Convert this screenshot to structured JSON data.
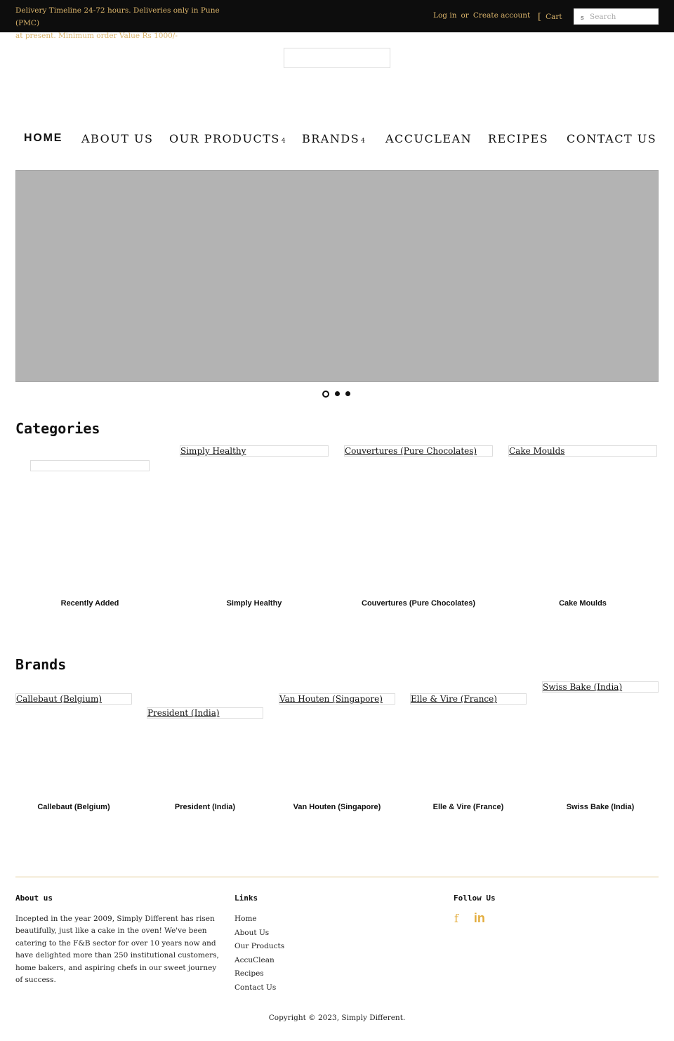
{
  "topbar": {
    "announcement_line1": "Delivery Timeline 24-72 hours. Deliveries only in Pune (PMC)",
    "announcement_line2": "at present. Minimum order Value Rs 1000/-",
    "login": "Log in",
    "or": "or",
    "create_account": "Create account",
    "cart_icon": "[",
    "cart": "Cart",
    "search_icon": "s",
    "search_placeholder": "Search",
    "search_value": ""
  },
  "nav": {
    "items": [
      {
        "label": "HOME",
        "active": true
      },
      {
        "label": "ABOUT US"
      },
      {
        "label": "OUR PRODUCTS",
        "caret": "4"
      },
      {
        "label": "BRANDS",
        "caret": "4"
      },
      {
        "label": "ACCUCLEAN"
      },
      {
        "label": "RECIPES"
      },
      {
        "label": "CONTACT US"
      }
    ]
  },
  "slider": {
    "slide_count": 3,
    "active_slide": 1
  },
  "categories": {
    "title": "Categories",
    "items": [
      {
        "alt": "",
        "caption": "Recently Added"
      },
      {
        "alt": "Simply Healthy",
        "caption": "Simply Healthy"
      },
      {
        "alt": "Couvertures (Pure Chocolates)",
        "caption": "Couvertures (Pure Chocolates)"
      },
      {
        "alt": "Cake Moulds",
        "caption": "Cake Moulds"
      }
    ]
  },
  "brands": {
    "title": "Brands",
    "items": [
      {
        "alt": "Callebaut (Belgium)",
        "caption": "Callebaut (Belgium)"
      },
      {
        "alt": "President (India)",
        "caption": "President (India)"
      },
      {
        "alt": "Van Houten (Singapore)",
        "caption": "Van Houten (Singapore)"
      },
      {
        "alt": "Elle & Vire (France)",
        "caption": "Elle & Vire (France)"
      },
      {
        "alt": "Swiss Bake (India)",
        "caption": "Swiss Bake (India)"
      }
    ]
  },
  "footer": {
    "about": {
      "title": "About us",
      "text": "Incepted in the year 2009, Simply Different has risen beautifully, just like a cake in the oven! We've been catering to the F&B sector for over 10 years now and have delighted more than 250 institutional customers, home bakers, and aspiring chefs in our sweet journey of success."
    },
    "links": {
      "title": "Links",
      "items": [
        "Home",
        "About Us",
        "Our Products",
        "AccuClean",
        "Recipes",
        "Contact Us"
      ]
    },
    "follow": {
      "title": "Follow Us",
      "facebook": "f",
      "linkedin": "in"
    },
    "copyright": "Copyright © 2023, Simply Different."
  },
  "colors": {
    "topbar_bg": "#0d0d0d",
    "accent_gold": "#d9b36a",
    "social_gold": "#e3ad3e",
    "slider_bg": "#b3b3b3",
    "footer_rule": "#e0c98f"
  }
}
